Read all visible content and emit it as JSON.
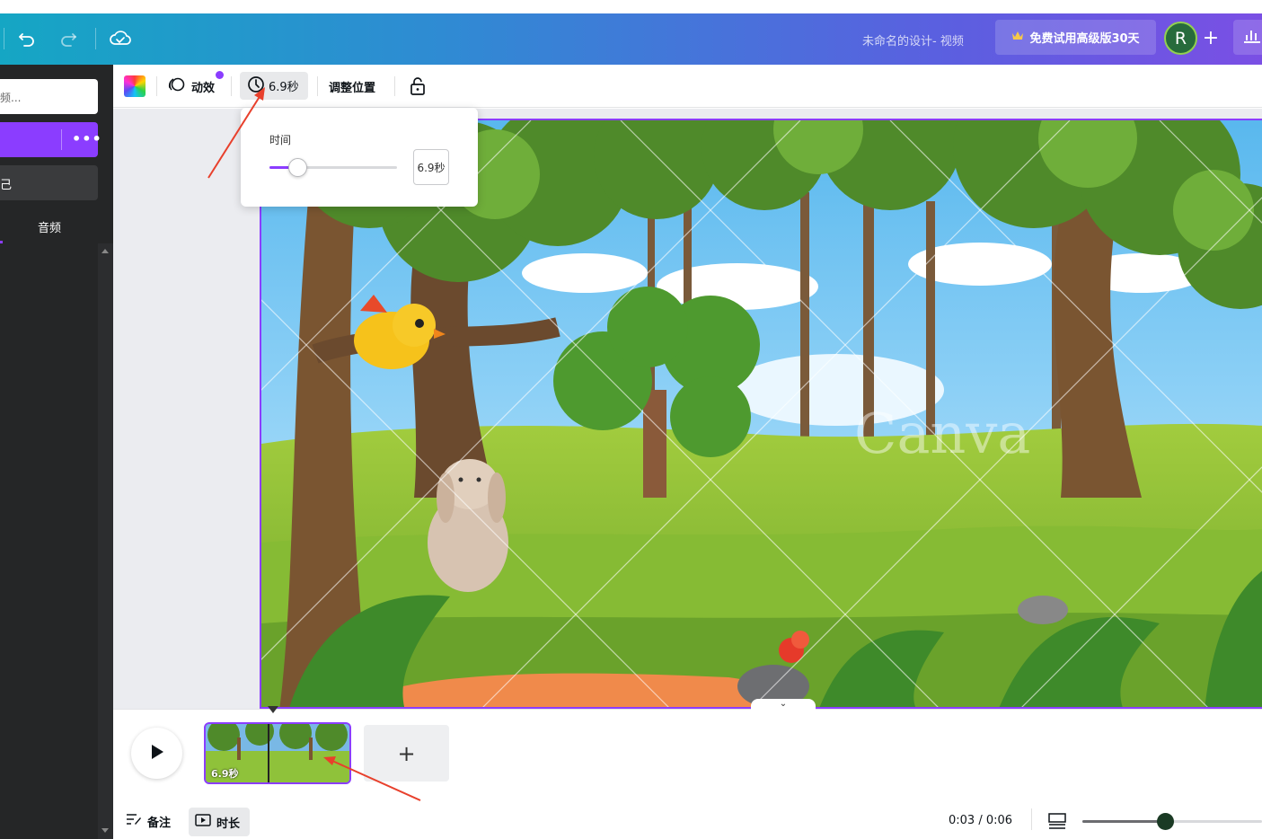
{
  "topbar": {
    "design_title": "未命名的设计- 视频",
    "pro_button_label": "免费试用高级版30天",
    "avatar_initial": "R",
    "plus_label": "+"
  },
  "sidebar": {
    "search_placeholder": "频...",
    "dark_button_label": "己",
    "audio_tab_label": "音频",
    "more_label": "•••"
  },
  "toolbar": {
    "animate_label": "动效",
    "duration_label": "6.9秒",
    "position_label": "调整位置"
  },
  "duration_popover": {
    "label": "时间",
    "value": "6.9秒",
    "slider_fraction": 0.22
  },
  "timeline": {
    "clip_label": "6.9秒",
    "add_label": "+",
    "notes_label": "备注",
    "duration_toggle_label": "时长",
    "time_readout": "0:03 / 0:06",
    "zoom_fraction": 0.46,
    "collapse_label": "⌄"
  },
  "colors": {
    "accent": "#8b3dff",
    "topbar_start": "#15a6c4",
    "topbar_end": "#7a4fe4",
    "sidebar_bg": "#252627",
    "annotation_arrow": "#e8402c"
  }
}
